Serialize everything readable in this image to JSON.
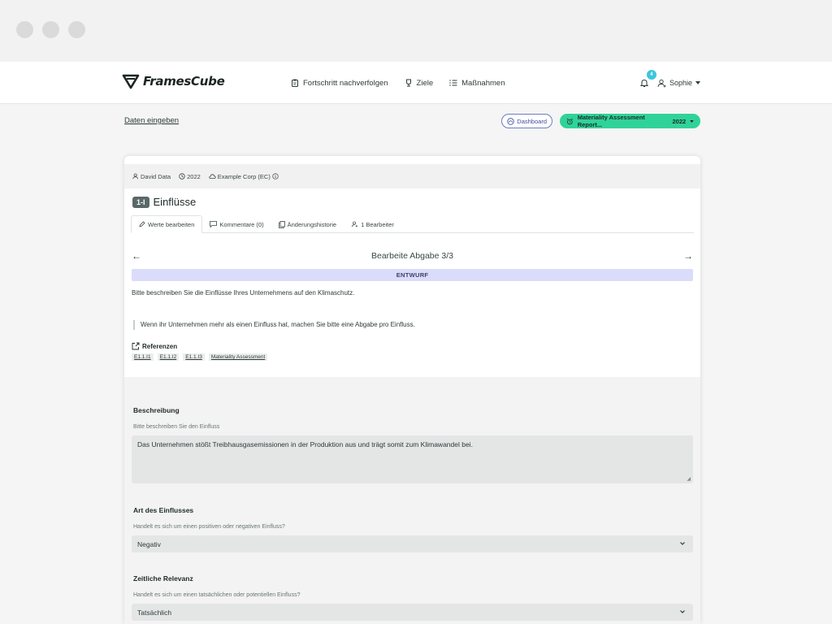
{
  "brand": {
    "name": "FramesCube"
  },
  "nav": {
    "items": [
      {
        "label": "Fortschritt nachverfolgen",
        "icon": "clipboard-icon"
      },
      {
        "label": "Ziele",
        "icon": "trophy-icon"
      },
      {
        "label": "Maßnahmen",
        "icon": "list-icon"
      }
    ],
    "notifications_count": "4",
    "user_name": "Sophie"
  },
  "subbar": {
    "breadcrumb": "Daten eingeben",
    "dashboard_label": "Dashboard",
    "report_label": "Materiality Assessment Report...",
    "report_year": "2022"
  },
  "meta": {
    "user": "David Data",
    "year": "2022",
    "company": "Example Corp (EC)"
  },
  "item": {
    "code": "1-I",
    "title": "Einflüsse"
  },
  "tabs": [
    {
      "label": "Werte bearbeiten",
      "icon": "pencil-icon"
    },
    {
      "label": "Kommentare (0)",
      "icon": "comment-icon"
    },
    {
      "label": "Änderungshistorie",
      "icon": "copy-icon"
    },
    {
      "label": "1 Bearbeiter",
      "icon": "user-add-icon"
    }
  ],
  "pager": {
    "title": "Bearbeite Abgabe 3/3"
  },
  "status": "ENTWURF",
  "description": "Bitte beschreiben Sie die Einflüsse Ihres Unternehmens auf den Klimaschutz.",
  "hint_quote": "Wenn ihr Unternehmen mehr als einen Einfluss hat, machen Sie bitte eine Abgabe pro Einfluss.",
  "references": {
    "title": "Referenzen",
    "tags": [
      "E1.1.I1",
      "E1.1.I2",
      "E1.1.I3",
      "Materiality Assessment"
    ]
  },
  "form": {
    "beschreibung": {
      "label": "Beschreibung",
      "hint": "Bitte beschreiben Sie den Einfluss",
      "value": "Das Unternehmen stößt Treibhausgasemissionen in der Produktion aus und trägt somit zum Klimawandel bei."
    },
    "art": {
      "label": "Art des Einflusses",
      "hint": "Handelt es sich um einen positiven oder negativen Einfluss?",
      "value": "Negativ"
    },
    "zeitlich": {
      "label": "Zeitliche Relevanz",
      "hint": "Handelt es sich um einen tatsächlichen oder potentiellen Einfluss?",
      "value": "Tatsächlich"
    }
  },
  "colors": {
    "accent_green": "#2fd39a",
    "status_bg": "#dadcfa",
    "badge_blue": "#3ec6dc"
  }
}
